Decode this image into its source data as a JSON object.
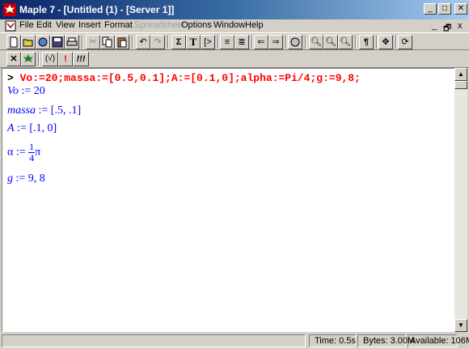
{
  "window": {
    "title": "Maple 7 - [Untitled (1) - [Server 1]]"
  },
  "titlebar_buttons": [
    "_",
    "□",
    "✕"
  ],
  "menu": [
    {
      "label": "File",
      "enabled": true
    },
    {
      "label": "Edit",
      "enabled": true
    },
    {
      "label": "View",
      "enabled": true
    },
    {
      "label": "Insert",
      "enabled": true
    },
    {
      "label": "Format",
      "enabled": true
    },
    {
      "label": "Spreadsheet",
      "enabled": false
    },
    {
      "label": "Options",
      "enabled": true
    },
    {
      "label": "Window",
      "enabled": true
    },
    {
      "label": "Help",
      "enabled": true
    }
  ],
  "mdi_controls": [
    "_",
    "🗗",
    "x"
  ],
  "toolbar2_labels": {
    "paren": "(√)",
    "exec": "!",
    "exec_all": "!!!"
  },
  "worksheet": {
    "prompt": ">",
    "input": "Vo:=20;massa:=[0.5,0.1];A:=[0.1,0];alpha:=Pi/4;g:=9,8;",
    "outputs": {
      "vo_lhs": "Vo",
      "vo_rhs": " := 20",
      "massa_lhs": "massa",
      "massa_rhs": " := [.5, .1]",
      "a_lhs": "A",
      "a_rhs": " := [.1, 0]",
      "alpha_lhs": "α",
      "alpha_assign": " := ",
      "alpha_num": "1",
      "alpha_den": "4",
      "alpha_pi": "π",
      "g_lhs": "g",
      "g_rhs": " := 9, 8"
    }
  },
  "status": {
    "time": "Time:   0.5s",
    "bytes": "Bytes: 3.00M",
    "available": "Available: 106M"
  },
  "colors": {
    "input": "#ff0000",
    "output": "#0000ff",
    "titlebar": "#0a246a"
  }
}
